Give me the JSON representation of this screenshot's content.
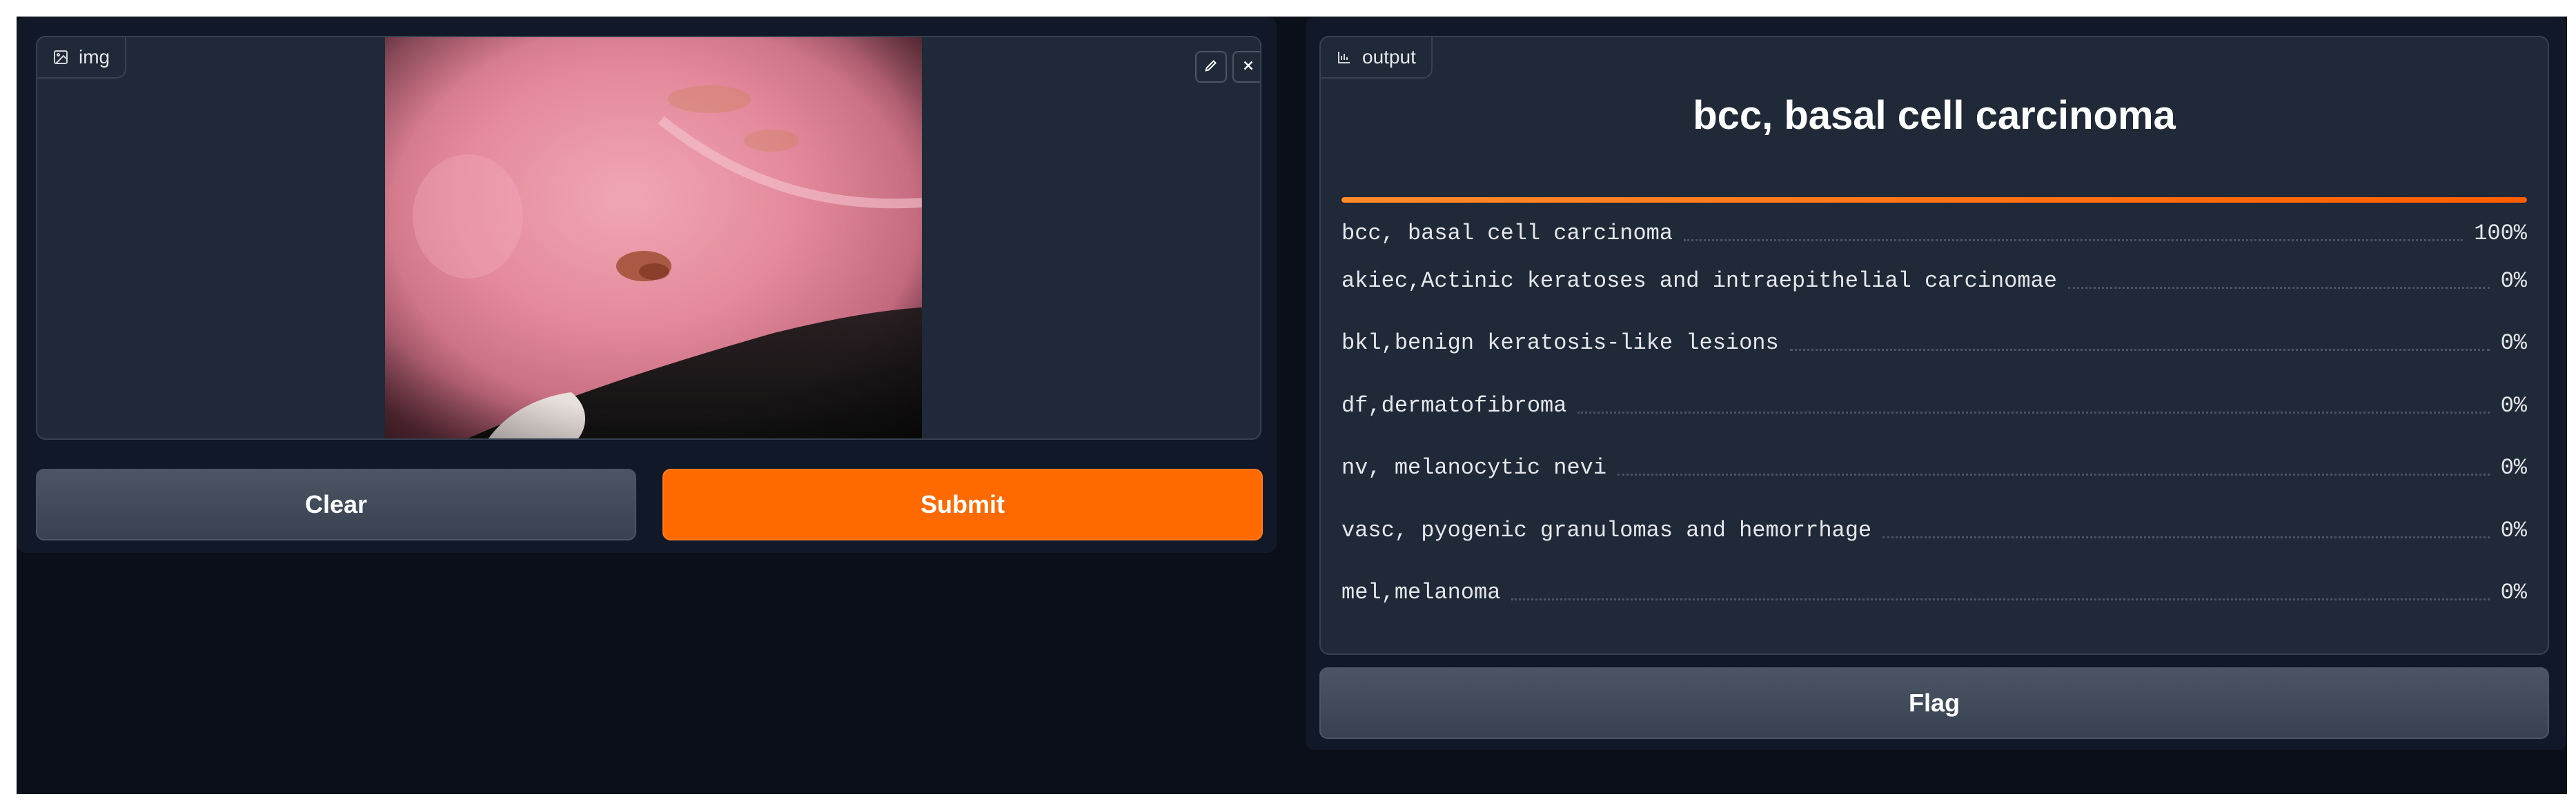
{
  "input": {
    "label": "img",
    "icon": "image-icon",
    "edit_icon": "pencil-icon",
    "close_icon": "close-icon"
  },
  "buttons": {
    "clear": "Clear",
    "submit": "Submit",
    "flag": "Flag"
  },
  "output": {
    "label": "output",
    "icon": "label-icon",
    "top_label": "bcc, basal cell carcinoma",
    "top_confidence": 1.0,
    "confidences": [
      {
        "label": "bcc, basal cell carcinoma",
        "value": "100%"
      },
      {
        "label": "akiec,Actinic keratoses and intraepithelial carcinomae",
        "value": "0%"
      },
      {
        "label": "bkl,benign keratosis-like lesions",
        "value": "0%"
      },
      {
        "label": "df,dermatofibroma",
        "value": "0%"
      },
      {
        "label": "nv, melanocytic nevi",
        "value": "0%"
      },
      {
        "label": "vasc, pyogenic granulomas and hemorrhage",
        "value": "0%"
      },
      {
        "label": "mel,melanoma",
        "value": "0%"
      }
    ]
  },
  "colors": {
    "background": "#0b0f19",
    "panel": "#111827",
    "block": "#1f2937",
    "border": "#374151",
    "accent": "#ff6a00"
  }
}
